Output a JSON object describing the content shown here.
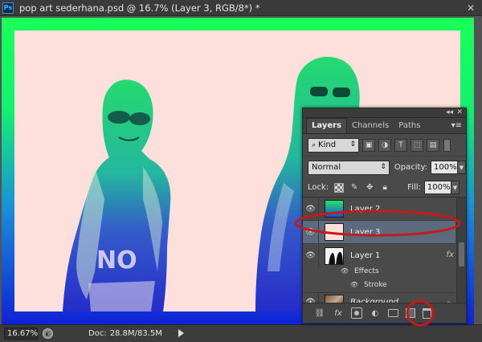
{
  "window": {
    "app_badge": "Ps",
    "title": "pop art sederhana.psd @ 16.7% (Layer 3, RGB/8*) *"
  },
  "status_bar": {
    "zoom": "16.67%",
    "doc_label": "Doc:",
    "doc_size": "28.8M/83.5M"
  },
  "panel": {
    "tabs": [
      {
        "label": "Layers",
        "active": true
      },
      {
        "label": "Channels",
        "active": false
      },
      {
        "label": "Paths",
        "active": false
      }
    ],
    "filter_kind": "Kind",
    "blend_mode": "Normal",
    "opacity_label": "Opacity:",
    "opacity_value": "100%",
    "lock_label": "Lock:",
    "fill_label": "Fill:",
    "fill_value": "100%",
    "layers": [
      {
        "name": "Layer 2",
        "selected": false,
        "italic": false
      },
      {
        "name": "Layer 3",
        "selected": true,
        "italic": false
      },
      {
        "name": "Layer 1",
        "selected": false,
        "italic": false,
        "fx": "fx"
      },
      {
        "name": "Background",
        "selected": false,
        "italic": true,
        "locked": true
      }
    ],
    "effects_label": "Effects",
    "stroke_label": "Stroke"
  },
  "colors": {
    "artwork_top": "#19ff58",
    "artwork_bottom": "#1022d6",
    "photo_bg": "#fde0dc",
    "selected_layer": "#5b6a7d",
    "annotation": "#c41a1a"
  }
}
